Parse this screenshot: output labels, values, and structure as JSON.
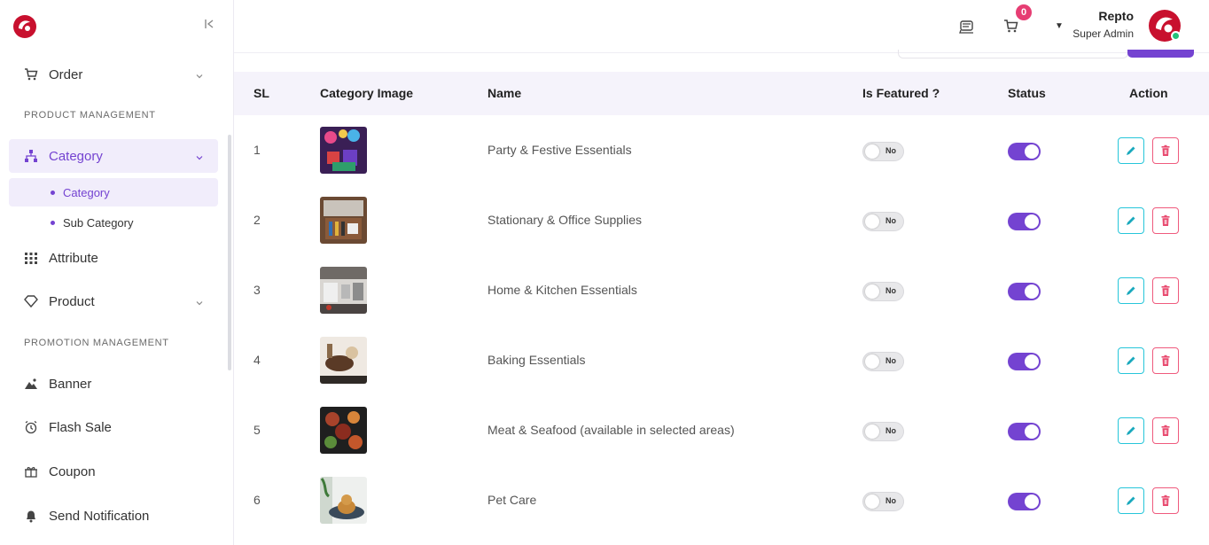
{
  "sidebar": {
    "collapse_label": "K",
    "order_label": "Order",
    "product_management_title": "PRODUCT MANAGEMENT",
    "category_label": "Category",
    "sub_items": [
      "Category",
      "Sub Category"
    ],
    "attribute_label": "Attribute",
    "product_label": "Product",
    "promotion_management_title": "PROMOTION MANAGEMENT",
    "banner_label": "Banner",
    "flash_sale_label": "Flash Sale",
    "coupon_label": "Coupon",
    "send_notification_label": "Send Notification"
  },
  "header": {
    "cart_count": "0",
    "user_name": "Repto",
    "user_role": "Super Admin"
  },
  "table": {
    "columns": [
      "SL",
      "Category Image",
      "Name",
      "Is Featured ?",
      "Status",
      "Action"
    ],
    "rows": [
      {
        "sl": "1",
        "name": "Party & Festive Essentials",
        "featured": "No",
        "status": "on",
        "image": "party"
      },
      {
        "sl": "2",
        "name": "Stationary & Office Supplies",
        "featured": "No",
        "status": "on",
        "image": "stationary"
      },
      {
        "sl": "3",
        "name": "Home & Kitchen Essentials",
        "featured": "No",
        "status": "on",
        "image": "kitchen"
      },
      {
        "sl": "4",
        "name": "Baking Essentials",
        "featured": "No",
        "status": "on",
        "image": "baking"
      },
      {
        "sl": "5",
        "name": "Meat & Seafood (available in selected areas)",
        "featured": "No",
        "status": "on",
        "image": "meat"
      },
      {
        "sl": "6",
        "name": "Pet Care",
        "featured": "No",
        "status": "on",
        "image": "pet"
      }
    ]
  },
  "colors": {
    "accent": "#7443d1",
    "edit": "#26c6da",
    "delete": "#ef5a7d",
    "badge": "#e63d73"
  }
}
